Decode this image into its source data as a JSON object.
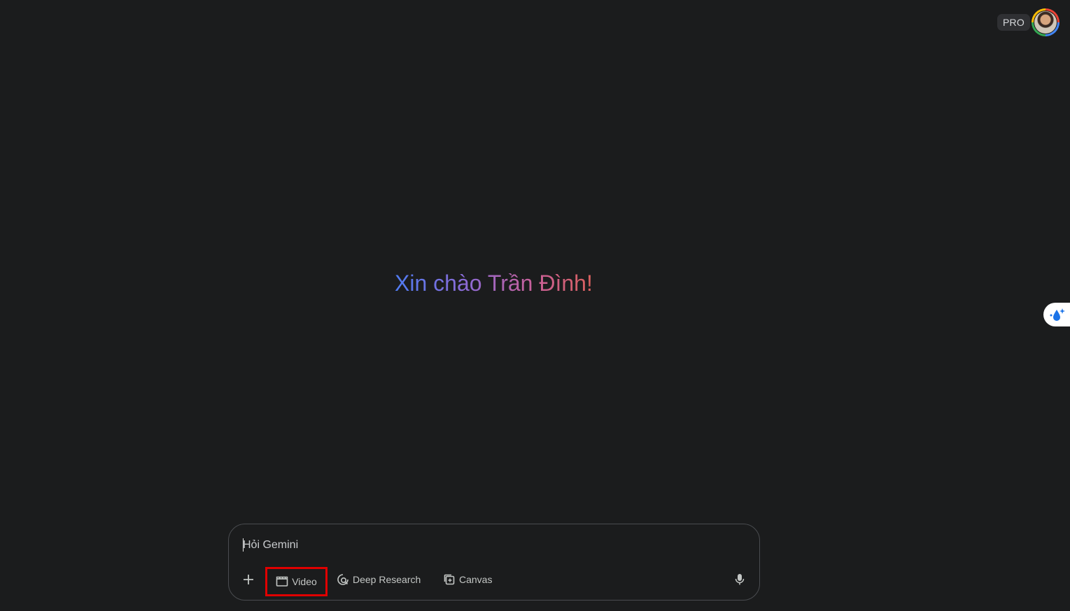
{
  "header": {
    "plan_badge": "PRO",
    "avatar_icon": "user-avatar"
  },
  "main": {
    "greeting": "Xin chào Trần Đình!"
  },
  "side_button": {
    "icon": "drop-sparkle-icon"
  },
  "prompt": {
    "placeholder": "Hỏi Gemini",
    "value": "",
    "tools": [
      {
        "label": "Video",
        "icon": "clapperboard-icon"
      },
      {
        "label": "Deep Research",
        "icon": "deep-research-icon"
      },
      {
        "label": "Canvas",
        "icon": "canvas-icon"
      }
    ],
    "add_icon": "plus-icon",
    "mic_icon": "microphone-icon"
  },
  "colors": {
    "background": "#1b1c1d",
    "greeting_gradient": [
      "#4f7cf3",
      "#8a6bd6",
      "#c8609a",
      "#d9605c"
    ],
    "highlight_border": "#e00000"
  }
}
